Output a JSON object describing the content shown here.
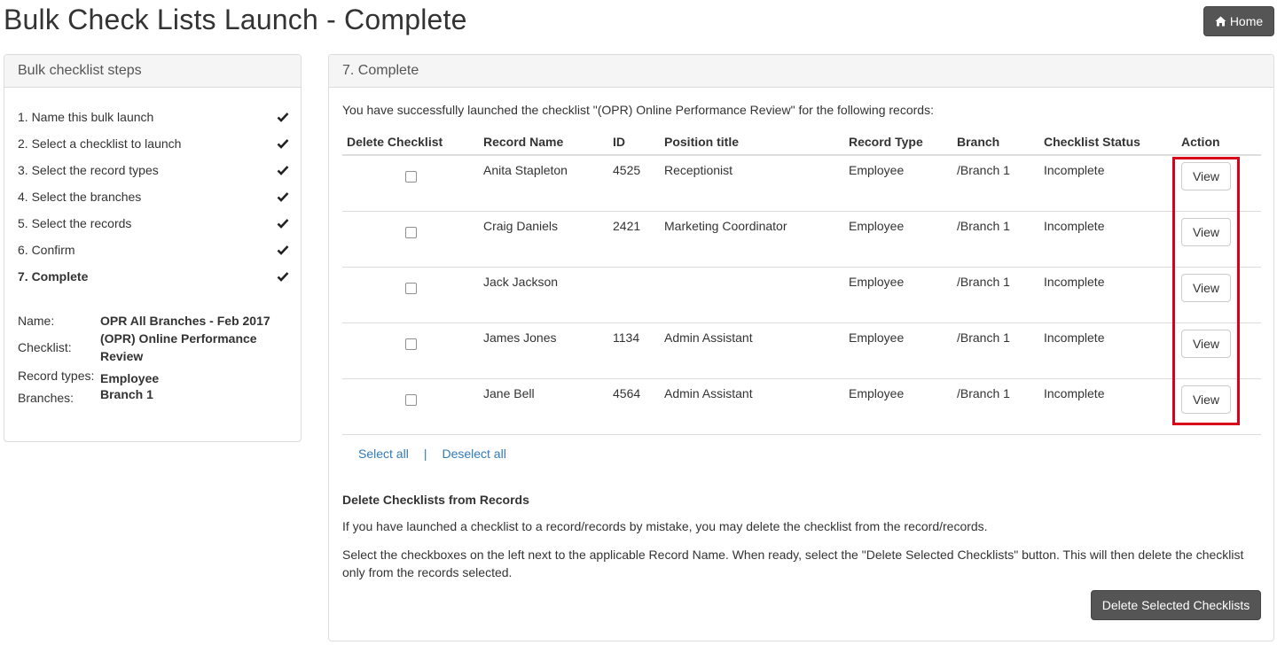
{
  "header": {
    "title": "Bulk Check Lists Launch - Complete",
    "home_label": "Home"
  },
  "sidebar": {
    "title": "Bulk checklist steps",
    "steps": [
      {
        "label": "1. Name this bulk launch"
      },
      {
        "label": "2. Select a checklist to launch"
      },
      {
        "label": "3. Select the record types"
      },
      {
        "label": "4. Select the branches"
      },
      {
        "label": "5. Select the records"
      },
      {
        "label": "6. Confirm"
      },
      {
        "label": "7. Complete"
      }
    ],
    "summary": {
      "name_label": "Name:",
      "name_value": "OPR All Branches - Feb 2017",
      "checklist_label": "Checklist:",
      "checklist_value": "(OPR) Online Performance Review",
      "record_types_label": "Record types:",
      "record_types_value": "Employee",
      "branches_label": "Branches:",
      "branches_value": "Branch 1"
    }
  },
  "main": {
    "title": "7. Complete",
    "intro": "You have successfully launched the checklist \"(OPR) Online Performance Review\" for the following records:",
    "columns": [
      "Delete Checklist",
      "Record Name",
      "ID",
      "Position title",
      "Record Type",
      "Branch",
      "Checklist Status",
      "Action"
    ],
    "rows": [
      {
        "name": "Anita Stapleton",
        "id": "4525",
        "position": "Receptionist",
        "type": "Employee",
        "branch": "/Branch 1",
        "status": "Incomplete",
        "action": "View"
      },
      {
        "name": "Craig Daniels",
        "id": "2421",
        "position": "Marketing Coordinator",
        "type": "Employee",
        "branch": "/Branch 1",
        "status": "Incomplete",
        "action": "View"
      },
      {
        "name": "Jack Jackson",
        "id": "",
        "position": "",
        "type": "Employee",
        "branch": "/Branch 1",
        "status": "Incomplete",
        "action": "View"
      },
      {
        "name": "James Jones",
        "id": "1134",
        "position": "Admin Assistant",
        "type": "Employee",
        "branch": "/Branch 1",
        "status": "Incomplete",
        "action": "View"
      },
      {
        "name": "Jane Bell",
        "id": "4564",
        "position": "Admin Assistant",
        "type": "Employee",
        "branch": "/Branch 1",
        "status": "Incomplete",
        "action": "View"
      }
    ],
    "select_all": "Select all",
    "separator": "|",
    "deselect_all": "Deselect all",
    "delete_section": {
      "title": "Delete Checklists from Records",
      "p1": "If you have launched a checklist to a record/records by mistake, you may delete the checklist from the record/records.",
      "p2": "Select the checkboxes on the left next to the applicable Record Name. When ready, select the \"Delete Selected Checklists\" button. This will then delete the checklist only from the records selected.",
      "button": "Delete Selected Checklists"
    }
  },
  "colors": {
    "accent_dark": "#555555",
    "link": "#337ab7",
    "highlight": "#d9001b"
  },
  "icons": {
    "home": "home-icon",
    "step_done": "check-icon"
  }
}
